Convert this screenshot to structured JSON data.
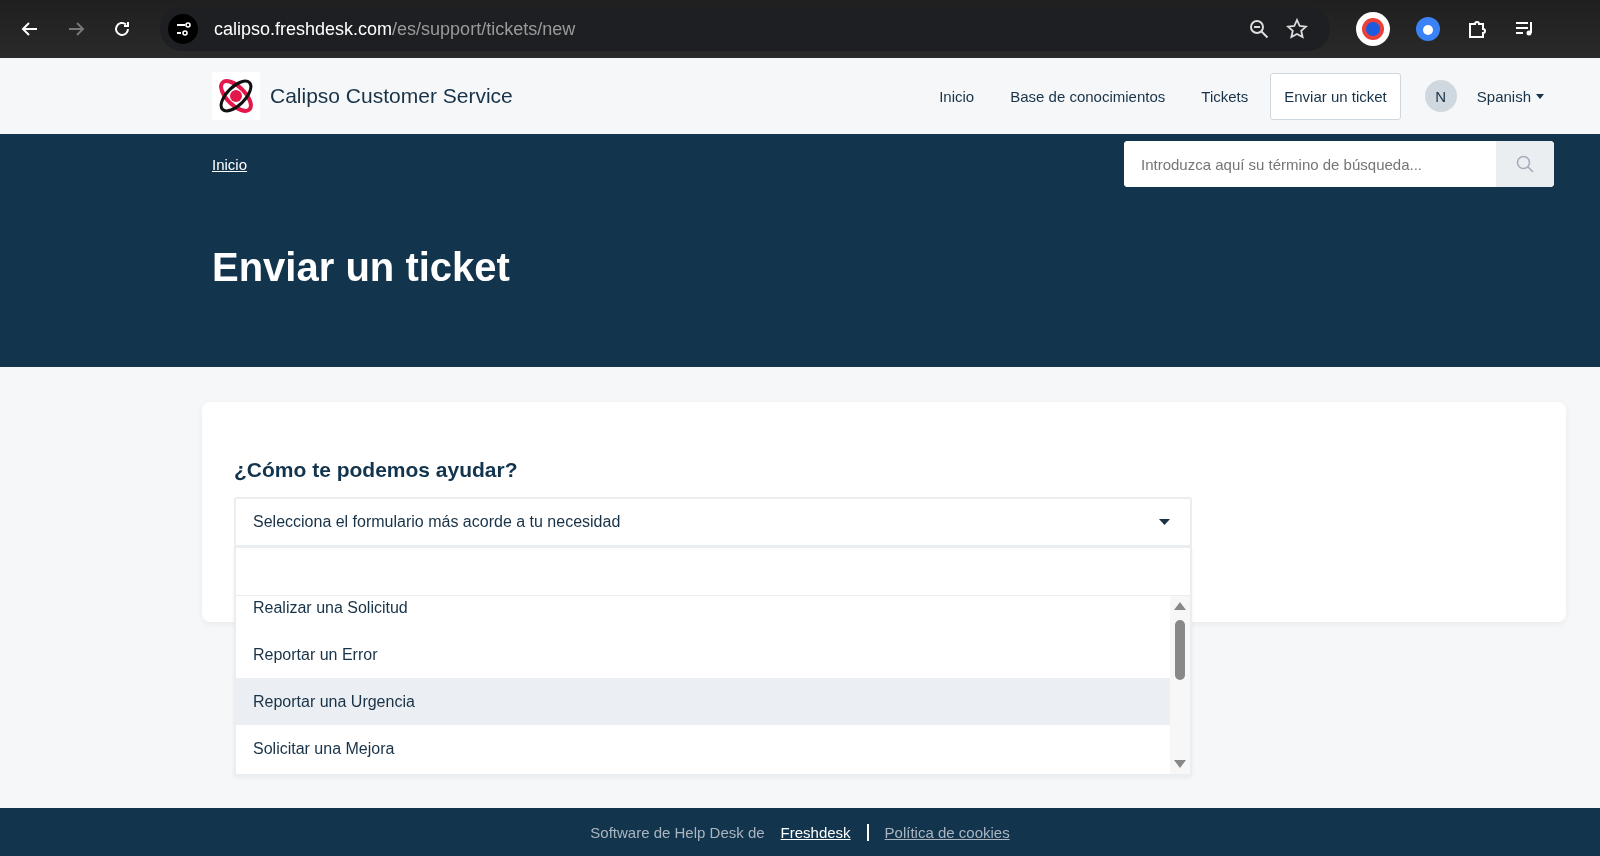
{
  "browser": {
    "url_host": "calipso.freshdesk.com",
    "url_path": "/es/support/tickets/new"
  },
  "header": {
    "brand": "Calipso Customer Service",
    "nav": [
      {
        "label": "Inicio",
        "selected": false
      },
      {
        "label": "Base de conocimientos",
        "selected": false
      },
      {
        "label": "Tickets",
        "selected": false
      },
      {
        "label": "Enviar un ticket",
        "selected": true
      }
    ],
    "avatar": "N",
    "language": "Spanish"
  },
  "banner": {
    "breadcrumb": "Inicio",
    "search": {
      "placeholder": "Introduzca aquí su término de búsqueda..."
    },
    "title": "Enviar un ticket"
  },
  "form": {
    "heading": "¿Cómo te podemos ayudar?",
    "select": {
      "value": "Selecciona el formulario más acorde a tu necesidad",
      "expanded": true
    },
    "options": [
      {
        "label": "Realizar una Solicitud",
        "selected": false
      },
      {
        "label": "Reportar un Error",
        "selected": false
      },
      {
        "label": "Reportar una Urgencia",
        "selected": true
      },
      {
        "label": "Solicitar una Mejora",
        "selected": false
      }
    ]
  },
  "footer": {
    "text": "Software de Help Desk de",
    "links": [
      "Freshdesk",
      "Política de cookies"
    ]
  }
}
